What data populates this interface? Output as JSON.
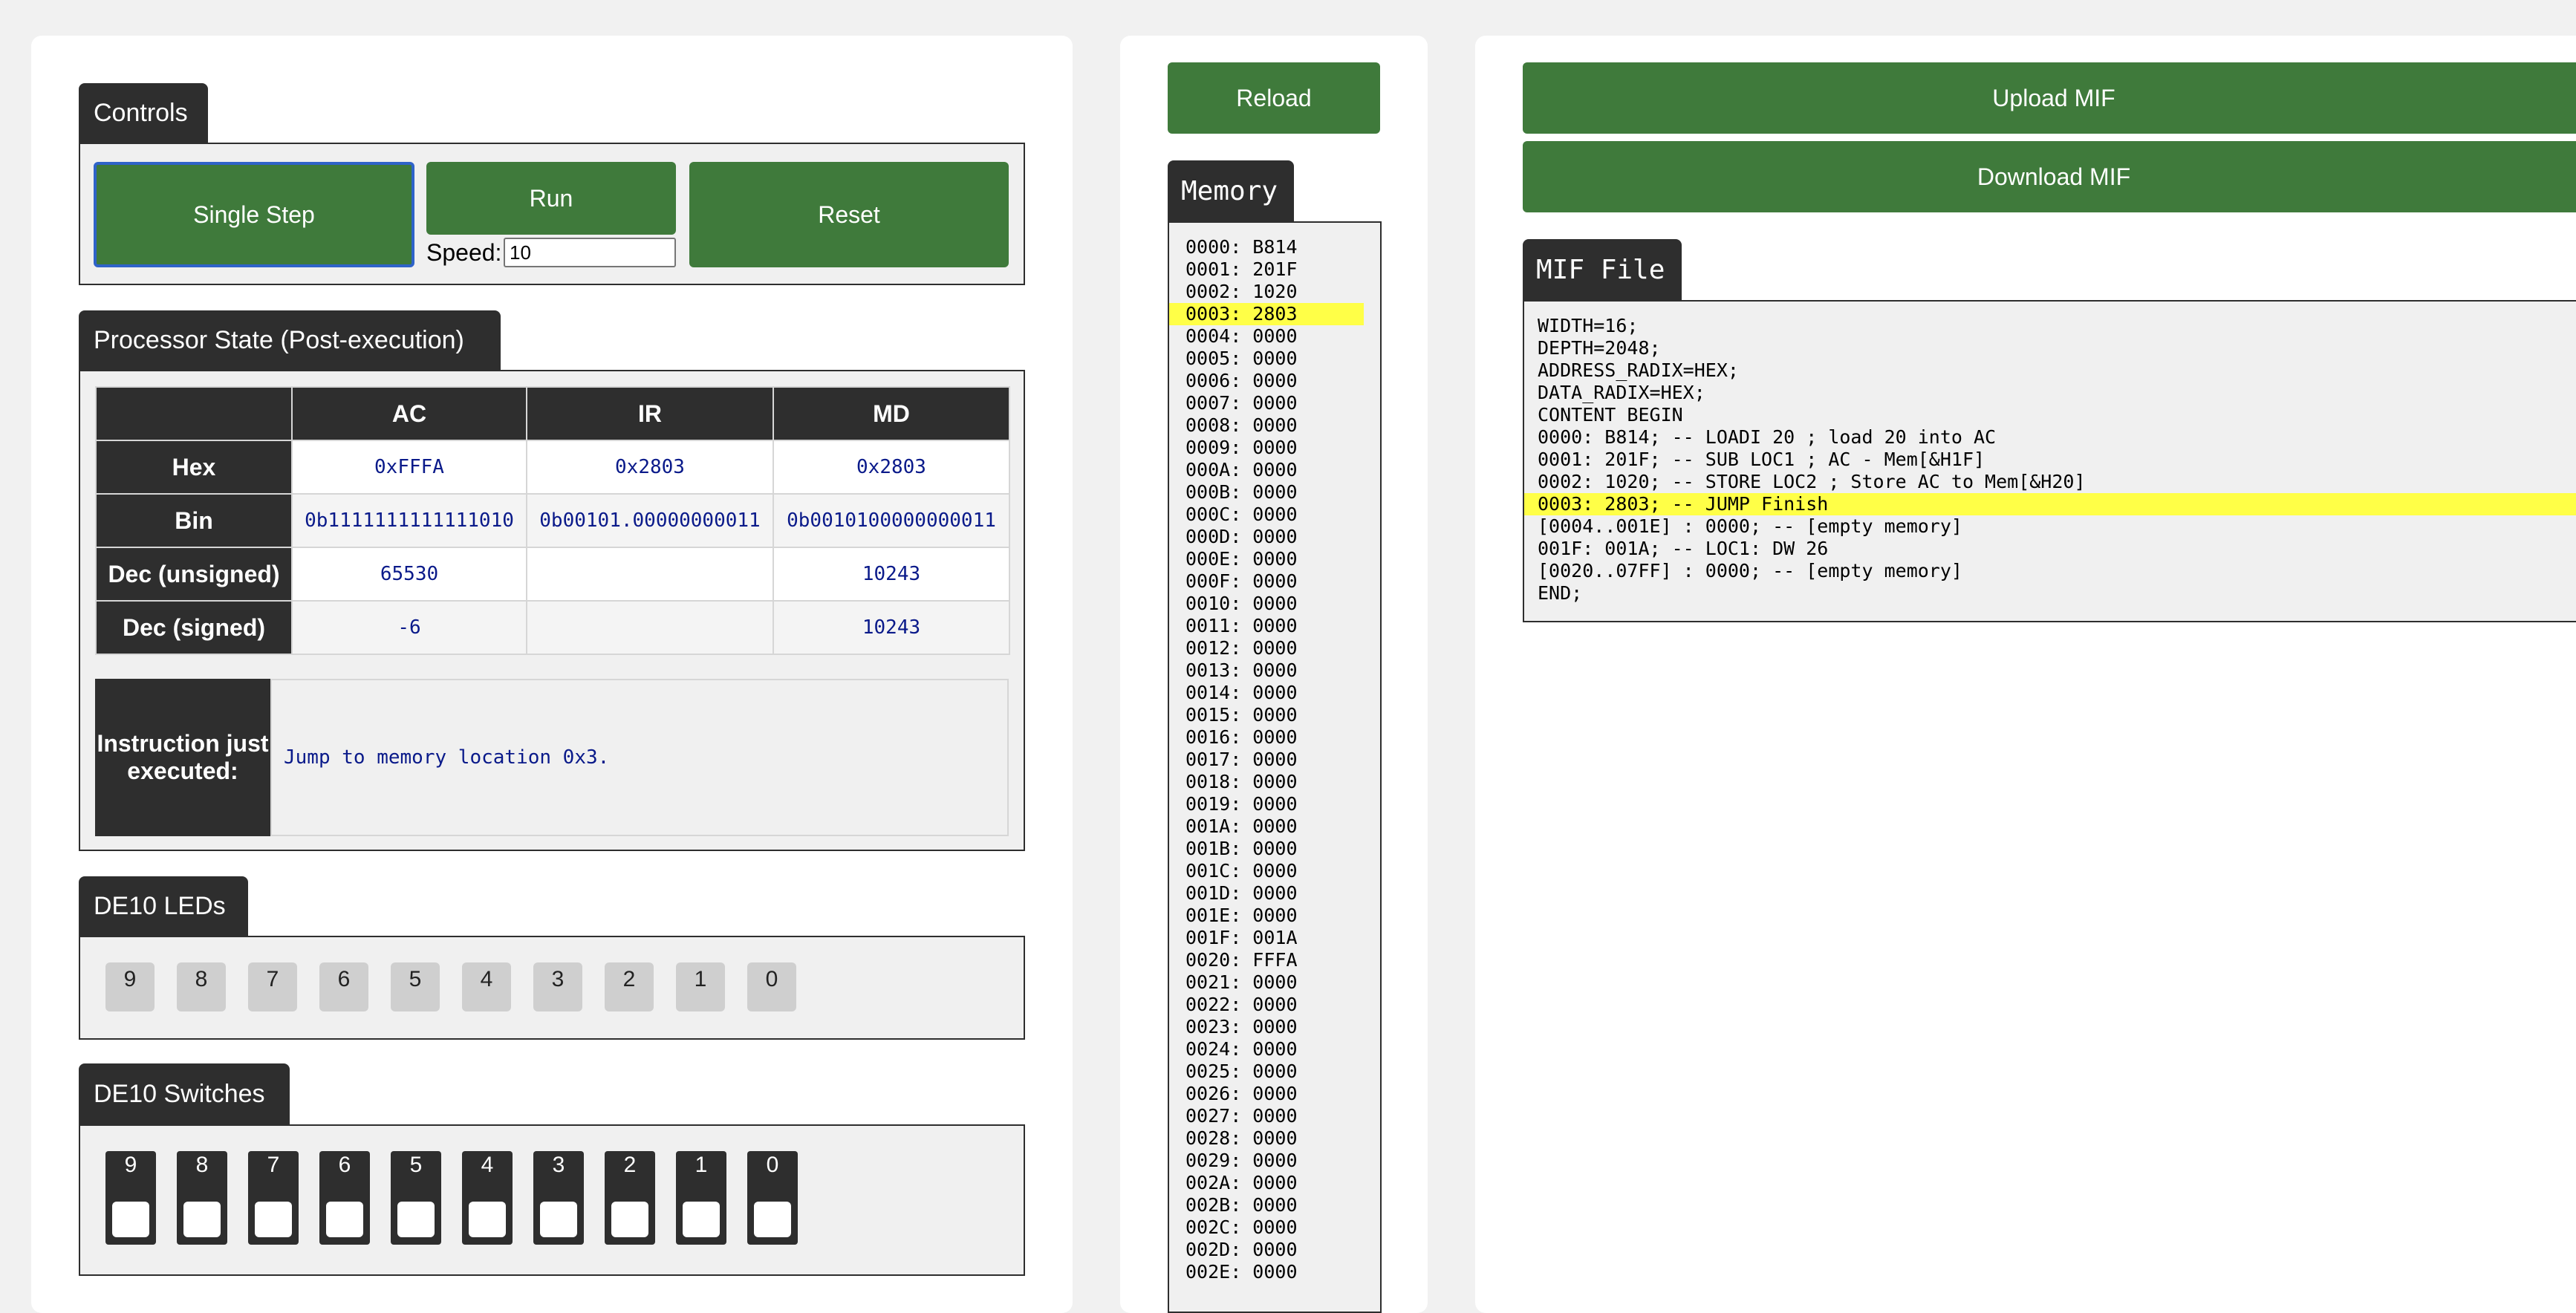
{
  "controls": {
    "title": "Controls",
    "single_step_label": "Single Step",
    "run_label": "Run",
    "reset_label": "Reset",
    "speed_label": "Speed:",
    "speed_value": "10"
  },
  "processor": {
    "title": "Processor State (Post-execution)",
    "columns": [
      "AC",
      "IR",
      "MD"
    ],
    "rows": [
      {
        "label": "Hex",
        "values": [
          "0xFFFA",
          "0x2803",
          "0x2803"
        ]
      },
      {
        "label": "Bin",
        "values": [
          "0b1111111111111010",
          "0b00101.00000000011",
          "0b0010100000000011"
        ]
      },
      {
        "label": "Dec (unsigned)",
        "values": [
          "65530",
          "",
          "10243"
        ]
      },
      {
        "label": "Dec (signed)",
        "values": [
          "-6",
          "",
          "10243"
        ]
      }
    ],
    "instruction_label": "Instruction just executed:",
    "instruction_text": "Jump to memory location 0x3."
  },
  "leds": {
    "title": "DE10 LEDs",
    "labels": [
      "9",
      "8",
      "7",
      "6",
      "5",
      "4",
      "3",
      "2",
      "1",
      "0"
    ]
  },
  "switches": {
    "title": "DE10 Switches",
    "labels": [
      "9",
      "8",
      "7",
      "6",
      "5",
      "4",
      "3",
      "2",
      "1",
      "0"
    ]
  },
  "memory": {
    "reload_label": "Reload",
    "title": "Memory",
    "highlight_index": 3,
    "lines": [
      "0000: B814",
      "0001: 201F",
      "0002: 1020",
      "0003: 2803",
      "0004: 0000",
      "0005: 0000",
      "0006: 0000",
      "0007: 0000",
      "0008: 0000",
      "0009: 0000",
      "000A: 0000",
      "000B: 0000",
      "000C: 0000",
      "000D: 0000",
      "000E: 0000",
      "000F: 0000",
      "0010: 0000",
      "0011: 0000",
      "0012: 0000",
      "0013: 0000",
      "0014: 0000",
      "0015: 0000",
      "0016: 0000",
      "0017: 0000",
      "0018: 0000",
      "0019: 0000",
      "001A: 0000",
      "001B: 0000",
      "001C: 0000",
      "001D: 0000",
      "001E: 0000",
      "001F: 001A",
      "0020: FFFA",
      "0021: 0000",
      "0022: 0000",
      "0023: 0000",
      "0024: 0000",
      "0025: 0000",
      "0026: 0000",
      "0027: 0000",
      "0028: 0000",
      "0029: 0000",
      "002A: 0000",
      "002B: 0000",
      "002C: 0000",
      "002D: 0000",
      "002E: 0000"
    ]
  },
  "mif": {
    "upload_label": "Upload MIF",
    "download_label": "Download MIF",
    "title": "MIF File",
    "highlight_index": 8,
    "lines": [
      "WIDTH=16;",
      "DEPTH=2048;",
      "ADDRESS_RADIX=HEX;",
      "DATA_RADIX=HEX;",
      "CONTENT BEGIN",
      "0000: B814; -- LOADI 20 ; load 20 into AC",
      "0001: 201F; -- SUB LOC1 ; AC - Mem[&H1F]",
      "0002: 1020; -- STORE LOC2 ; Store AC to Mem[&H20]",
      "0003: 2803; -- JUMP Finish",
      "[0004..001E] : 0000; -- [empty memory]",
      "001F: 001A; -- LOC1: DW 26",
      "[0020..07FF] : 0000; -- [empty memory]",
      "END;"
    ]
  },
  "colors": {
    "button_green": "#3f7a3b",
    "header_dark": "#2e2e2e",
    "highlight_yellow": "#ffff47",
    "focus_blue": "#2f63c9",
    "value_navy": "#0a1a8a"
  }
}
